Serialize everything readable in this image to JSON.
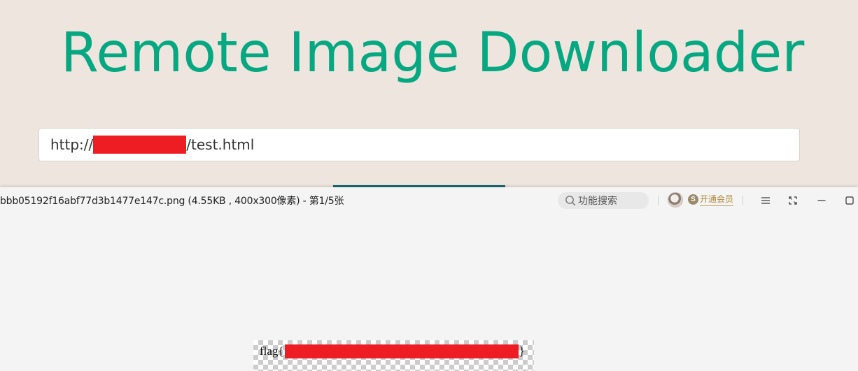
{
  "web_page": {
    "title": "Remote Image Downloader",
    "url_input": {
      "prefix": "http://",
      "suffix": "/test.html"
    },
    "colors": {
      "background": "#eee5de",
      "title": "#05a880",
      "redaction": "#ee1d24"
    }
  },
  "viewer": {
    "file_info": "bbb05192f16abf77d3b1477e147c.png (4.55KB , 400x300像素) - 第1/5张",
    "search_placeholder": "功能搜索",
    "vip_badge": "S",
    "vip_label": "开通会员",
    "icons": {
      "search": "search-icon",
      "menu": "menu-icon",
      "fullscreen": "fullscreen-icon",
      "minimize": "minimize-icon",
      "maximize": "maximize-icon"
    }
  },
  "image_content": {
    "flag_prefix": "flag{",
    "flag_suffix": "}"
  }
}
